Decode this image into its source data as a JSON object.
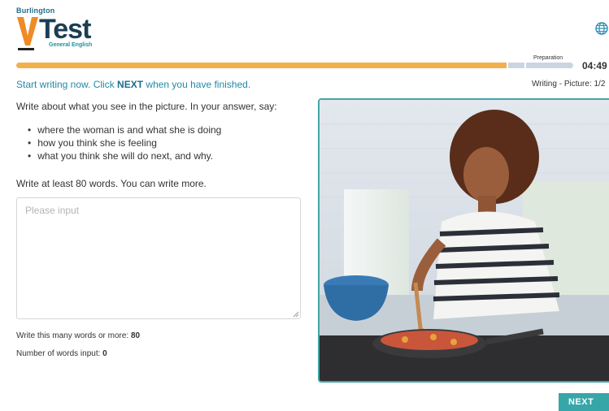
{
  "header": {
    "brand_top": "Burlington",
    "brand_main": "Test",
    "brand_sub": "General English"
  },
  "progress": {
    "stage_label": "Preparation",
    "timer": "04:49",
    "fraction_complete": 0.88
  },
  "instruction": {
    "before": "Start writing now. Click ",
    "emphasis": "NEXT",
    "after": " when you have finished."
  },
  "section_label": "Writing - Picture: 1/2",
  "task": {
    "prompt": "Write about what you see in the picture. In your answer, say:",
    "bullets": [
      "where the woman is and what she is doing",
      "how you think she is feeling",
      "what you think she will do next, and why."
    ],
    "min_words_instruction": "Write at least 80 words. You can write more."
  },
  "answer": {
    "value": "",
    "placeholder": "Please input"
  },
  "stats": {
    "min_words_label": "Write this many words or more: ",
    "min_words_value": "80",
    "count_label": "Number of words input: ",
    "count_value": "0"
  },
  "next_label": "NEXT",
  "colors": {
    "accent": "#37a6a8",
    "progress": "#f1b04c",
    "brand_orange": "#f08a24",
    "brand_navy": "#1b3e55"
  }
}
